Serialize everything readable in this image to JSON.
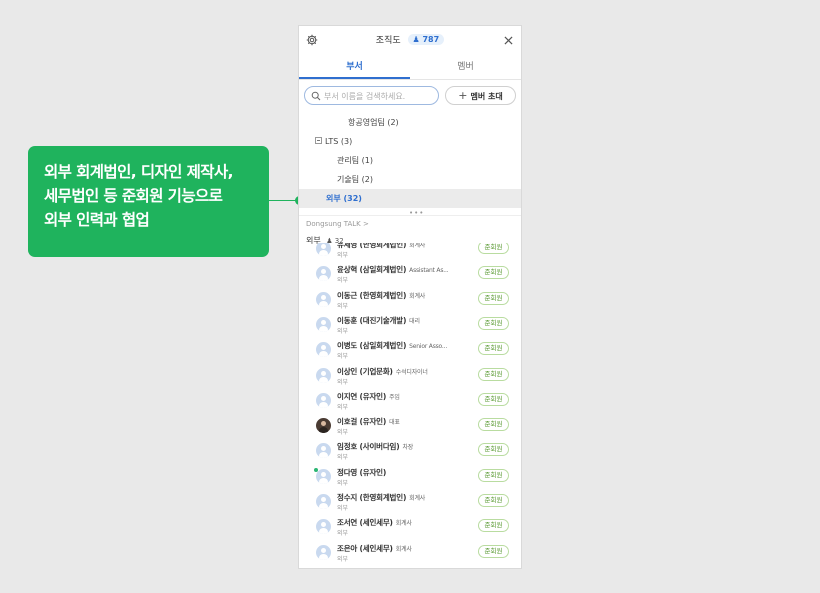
{
  "callout": {
    "lines": [
      "외부 회계법인, 디자인 제작사,",
      "세무법인 등 준회원 기능으로",
      "외부 인력과 협업"
    ]
  },
  "panel": {
    "title": "조직도",
    "count": "787",
    "tabs": [
      {
        "label": "부서",
        "active": true
      },
      {
        "label": "멤버",
        "active": false
      }
    ],
    "search_placeholder": "부서 이름을 검색하세요.",
    "invite_label": "멤버 초대",
    "tree": [
      {
        "label": "항공영업팀 (2)",
        "level": 2,
        "toggle": false,
        "selected": false
      },
      {
        "label": "LTS (3)",
        "level": 0,
        "toggle": true,
        "selected": false
      },
      {
        "label": "관리팀 (1)",
        "level": 1,
        "toggle": false,
        "selected": false
      },
      {
        "label": "기술팀 (2)",
        "level": 1,
        "toggle": false,
        "selected": false
      },
      {
        "label": "외부 (32)",
        "level": 0.5,
        "toggle": false,
        "selected": true
      }
    ],
    "sub": {
      "crumb": "Dongsung TALK  >",
      "title": "외부",
      "count": "32"
    },
    "badge_label": "준회원",
    "members": [
      {
        "name": "유세영 (한영회계법인)",
        "role": "회계사",
        "dept": "외부",
        "photo": false,
        "online": false
      },
      {
        "name": "윤상혁 (삼일회계법인)",
        "role": "Assistant As...",
        "dept": "외부",
        "photo": false,
        "online": false
      },
      {
        "name": "이동근 (한영회계법인)",
        "role": "회계사",
        "dept": "외부",
        "photo": false,
        "online": false
      },
      {
        "name": "이동훈 (대진기술개발)",
        "role": "대리",
        "dept": "외부",
        "photo": false,
        "online": false
      },
      {
        "name": "이병도 (삼일회계법인)",
        "role": "Senior Asso...",
        "dept": "외부",
        "photo": false,
        "online": false
      },
      {
        "name": "이상인 (기업문화)",
        "role": "수석디자이너",
        "dept": "외부",
        "photo": false,
        "online": false
      },
      {
        "name": "이지연 (유자인)",
        "role": "주임",
        "dept": "외부",
        "photo": false,
        "online": false
      },
      {
        "name": "이호걸 (유자인)",
        "role": "대표",
        "dept": "외부",
        "photo": true,
        "online": false
      },
      {
        "name": "임정호 (사이버다임)",
        "role": "차장",
        "dept": "외부",
        "photo": false,
        "online": false
      },
      {
        "name": "정다영 (유자인)",
        "role": "",
        "dept": "외부",
        "photo": false,
        "online": true
      },
      {
        "name": "정수지 (한영회계법인)",
        "role": "회계사",
        "dept": "외부",
        "photo": false,
        "online": false
      },
      {
        "name": "조서연 (세인세무)",
        "role": "회계사",
        "dept": "외부",
        "photo": false,
        "online": false
      },
      {
        "name": "조은아 (세인세무)",
        "role": "회계사",
        "dept": "외부",
        "photo": false,
        "online": false
      }
    ]
  }
}
